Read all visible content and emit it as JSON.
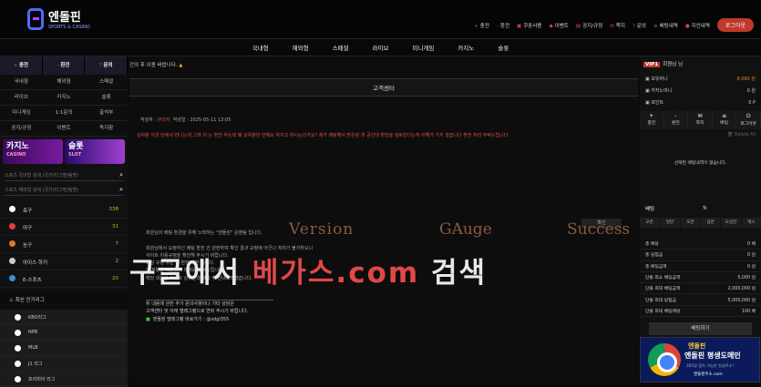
{
  "brand": {
    "name_kr": "엔돌핀",
    "name_en": "SPORTS & CASINO"
  },
  "topnav": [
    {
      "icon": "plus-icon",
      "label": "충전"
    },
    {
      "icon": "minus-icon",
      "label": "환전"
    },
    {
      "icon": "coupon-icon",
      "label": "쿠폰사용"
    },
    {
      "icon": "gift-icon",
      "label": "이벤트"
    },
    {
      "icon": "notice-icon",
      "label": "공지/규정"
    },
    {
      "icon": "mail-icon",
      "label": "쪽지"
    },
    {
      "icon": "question-icon",
      "label": "문의"
    },
    {
      "icon": "list-icon",
      "label": "배팅내역"
    },
    {
      "icon": "user-icon",
      "label": "지인내역"
    }
  ],
  "logout_label": "로그아웃",
  "mainnav": [
    "국내형",
    "해외형",
    "스페셜",
    "라이브",
    "미니게임",
    "카지노",
    "슬롯"
  ],
  "left": {
    "buttons": [
      {
        "sym": "+",
        "label": "충전"
      },
      {
        "sym": "-",
        "label": "환전"
      },
      {
        "sym": "?",
        "label": "문의"
      }
    ],
    "grid": [
      "국내형",
      "해외형",
      "스페셜",
      "라이브",
      "카지노",
      "슬롯",
      "미니게임",
      "1:1문의",
      "출석부",
      "공지/규정",
      "이벤트",
      "독지함"
    ],
    "banners": [
      {
        "title": "카지노",
        "sub": "CASINO"
      },
      {
        "title": "슬롯",
        "sub": "SLOT"
      }
    ],
    "search1": "스포츠 국내형 검색 (국가/리그명/팀명)",
    "search2": "스포츠 해외형 검색 (국가/리그명/팀명)",
    "sports": [
      {
        "name": "축구",
        "count": "338",
        "color": "#ffffff"
      },
      {
        "name": "야구",
        "count": "31",
        "color": "#e04040"
      },
      {
        "name": "농구",
        "count": "7",
        "color": "#e07a20"
      },
      {
        "name": "아이스 하키",
        "count": "2",
        "color": "#cccccc"
      },
      {
        "name": "E-스포츠",
        "count": "20",
        "color": "#3a8fd0"
      }
    ],
    "league_header": "최신 인기리그",
    "leagues": [
      "KBO리그",
      "NPB",
      "MLB",
      "J1 리그",
      "프리미어 리그"
    ]
  },
  "center": {
    "notice": "간의 후 이용 바랍니다.",
    "title": "고객센터",
    "meta_label": "작성자 :",
    "author": "관리자",
    "date_label": "작성일 : 2025-05-11 13:05",
    "message": "상위분 지금 안에서 만나는데 그래 저 는 환전 하는데 왜 상위분만 안해요 하지고 하시는건가요? 제가 배팅해서 받은된 게 공인데 환전을 검토한다는게 이해가 가지 않습니다 환전 처리 부탁드립니다",
    "confirm_label": "확인",
    "lines": [
      "회원님의 배팅 환경을 위해 노력하는 \"엔돌핀\" 운영팀 입니다.",
      "",
      "회원님께서 요청하신 배팅 환전 건 관련하여 확인 결과 규정에 어긋나 처리가 불가하오니",
      "사이트 이용규정을 확인해 주시기 바랍니다.",
      "배팅 규정 위반 시 환전 제한 됩니다.",
      "이 부분은 회원님의 이해를 부탁드립니다.",
      "해당 내용을 토대로 상위분과 대화 후 안내드리겠습니다."
    ],
    "lines2": [
      "위 내용에 관한 추가 문의사항이나 기타 상담은",
      "고객센터 및 아래 텔레그램으로 연락 주시기 바랍니다.",
      "엔돌핀 텔레그램 바로가기 : @sdgl355"
    ],
    "watermark_words": [
      "Version",
      "GAuge",
      "Success"
    ],
    "watermark_big_a": "구글에서 ",
    "watermark_big_b": "베가스.com",
    "watermark_big_c": " 검색"
  },
  "right": {
    "vip_tag": "VIP1",
    "vip_user": "회원님 님",
    "balance_label": "보유머니",
    "balance_value": "8,080 원",
    "casino_label": "카지노머니",
    "casino_value": "0 원",
    "point_label": "포인트",
    "point_value": "0 P",
    "buttons": [
      "충전",
      "환전",
      "쪽지",
      "배팅",
      "로그아웃"
    ],
    "delete_all": "Delete All",
    "no_selection": "선택된 배팅내역이 없습니다.",
    "bet_label": "배팅",
    "chips": [
      "오만",
      "일만",
      "오만",
      "십만",
      "오십만",
      "맥스"
    ],
    "rows": [
      {
        "label": "총 배당",
        "value": "0 배"
      },
      {
        "label": "총 당첨금",
        "value": "0 원"
      },
      {
        "label": "총 배팅금액",
        "value": "0 원"
      },
      {
        "label": "단폴 최소 배팅금액",
        "value": "5,000 원"
      },
      {
        "label": "단폴 최대 배팅금액",
        "value": "2,000,000 원"
      },
      {
        "label": "단폴 최대 당첨금",
        "value": "5,000,000 원"
      },
      {
        "label": "단폴 최대 배팅배당",
        "value": "100 배"
      }
    ],
    "bet_button": "배팅하기",
    "ad": {
      "line1": "엔돌핀",
      "line2": "엔돌핀 평생도메인",
      "line3": "365일 접속 가능한 한글주소!",
      "line4": "엔돌핀주소.com"
    }
  }
}
